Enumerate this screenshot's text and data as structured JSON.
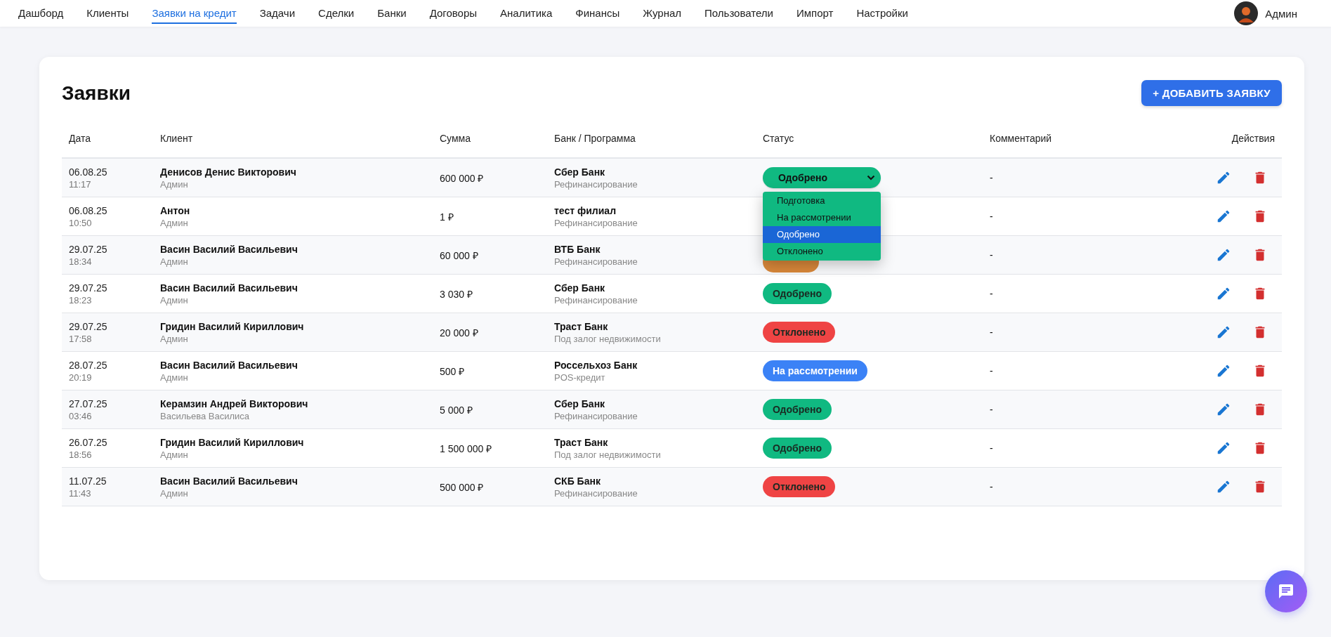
{
  "nav": {
    "items": [
      {
        "label": "Дашборд",
        "selected": false
      },
      {
        "label": "Клиенты",
        "selected": false
      },
      {
        "label": "Заявки на кредит",
        "selected": true
      },
      {
        "label": "Задачи",
        "selected": false
      },
      {
        "label": "Сделки",
        "selected": false
      },
      {
        "label": "Банки",
        "selected": false
      },
      {
        "label": "Договоры",
        "selected": false
      },
      {
        "label": "Аналитика",
        "selected": false
      },
      {
        "label": "Финансы",
        "selected": false
      },
      {
        "label": "Журнал",
        "selected": false
      },
      {
        "label": "Пользователи",
        "selected": false
      },
      {
        "label": "Импорт",
        "selected": false
      },
      {
        "label": "Настройки",
        "selected": false
      }
    ],
    "user": "Админ"
  },
  "page": {
    "title": "Заявки",
    "add_button": "+ ДОБАВИТЬ ЗАЯВКУ"
  },
  "table": {
    "columns": [
      "Дата",
      "Клиент",
      "Сумма",
      "Банк / Программа",
      "Статус",
      "Комментарий",
      "Действия"
    ],
    "rows": [
      {
        "date": "06.08.25",
        "time": "11:17",
        "client": "Денисов Денис Викторович",
        "manager": "Админ",
        "amount": "600 000 ₽",
        "bank": "Сбер Банк",
        "program": "Рефинансирование",
        "status": {
          "kind": "approved",
          "label": "Одобрено",
          "options": [
            {
              "label": "Подготовка",
              "selected": false
            },
            {
              "label": "На рассмотрении",
              "selected": false
            },
            {
              "label": "Одобрено",
              "selected": true
            },
            {
              "label": "Отклонено",
              "selected": false
            }
          ]
        },
        "comment": "-"
      },
      {
        "date": "06.08.25",
        "time": "10:50",
        "client": "Антон",
        "manager": "Админ",
        "amount": "1 ₽",
        "bank": "тест филиал",
        "program": "Рефинансирование",
        "comment": "-"
      },
      {
        "date": "29.07.25",
        "time": "18:34",
        "client": "Васин Василий Васильевич",
        "manager": "Админ",
        "amount": "60 000 ₽",
        "bank": "ВТБ Банк",
        "program": "Рефинансирование",
        "status": {
          "kind": "preparing"
        },
        "comment": "-"
      },
      {
        "date": "29.07.25",
        "time": "18:23",
        "client": "Васин Василий Васильевич",
        "manager": "Админ",
        "amount": "3 030 ₽",
        "bank": "Сбер Банк",
        "program": "Рефинансирование",
        "status": {
          "kind": "approved",
          "label": "Одобрено"
        },
        "comment": "-"
      },
      {
        "date": "29.07.25",
        "time": "17:58",
        "client": "Гридин Василий Кириллович",
        "manager": "Админ",
        "amount": "20 000 ₽",
        "bank": "Траст Банк",
        "program": "Под залог недвижимости",
        "status": {
          "kind": "rejected",
          "label": "Отклонено"
        },
        "comment": "-"
      },
      {
        "date": "28.07.25",
        "time": "20:19",
        "client": "Васин Василий Васильевич",
        "manager": "Админ",
        "amount": "500 ₽",
        "bank": "Россельхоз Банк",
        "program": "POS-кредит",
        "status": {
          "kind": "review",
          "label": "На рассмотрении"
        },
        "comment": "-"
      },
      {
        "date": "27.07.25",
        "time": "03:46",
        "client": "Керамзин Андрей Викторович",
        "manager": "Васильева Василиса",
        "amount": "5 000 ₽",
        "bank": "Сбер Банк",
        "program": "Рефинансирование",
        "status": {
          "kind": "approved",
          "label": "Одобрено"
        },
        "comment": "-"
      },
      {
        "date": "26.07.25",
        "time": "18:56",
        "client": "Гридин Василий Кириллович",
        "manager": "Админ",
        "amount": "1 500 000 ₽",
        "bank": "Траст Банк",
        "program": "Под залог недвижимости",
        "status": {
          "kind": "approved",
          "label": "Одобрено"
        },
        "comment": "-"
      },
      {
        "date": "11.07.25",
        "time": "11:43",
        "client": "Васин Василий Васильевич",
        "manager": "Админ",
        "amount": "500 000 ₽",
        "bank": "СКБ Банк",
        "program": "Рефинансирование",
        "status": {
          "kind": "rejected",
          "label": "Отклонено"
        },
        "comment": "-"
      }
    ]
  }
}
